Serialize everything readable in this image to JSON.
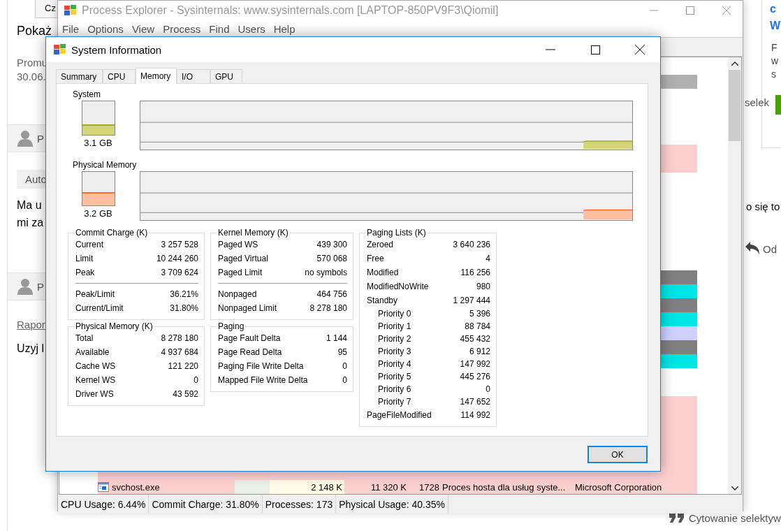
{
  "background_page": {
    "left": {
      "top_button": "Cz",
      "heading": "Pokaż",
      "meta": [
        "Promu",
        "30.06."
      ],
      "posts": [
        {
          "author": "P"
        },
        {
          "author": "P"
        }
      ],
      "label": "Auto",
      "body": [
        "Ma u",
        "mi za"
      ],
      "report_link": "Rapor",
      "body2": "Uzyj l"
    },
    "right": {
      "links": [
        "c",
        "W"
      ],
      "lines": [
        "F",
        "w",
        "s"
      ],
      "side_text": "selek",
      "body": "o się to",
      "reply": "Od",
      "quote": "Cytowanie selektyw"
    }
  },
  "process_explorer": {
    "title": "Process Explorer - Sysinternals: www.sysinternals.com [LAPTOP-850PV9F3\\Qiomil]",
    "menu": [
      "File",
      "Options",
      "View",
      "Process",
      "Find",
      "Users",
      "Help"
    ],
    "rows": [
      {
        "kind": "blank"
      },
      {
        "kind": "process",
        "color": "#b0b0b0"
      },
      {
        "kind": "blank"
      },
      {
        "kind": "blank"
      },
      {
        "kind": "blank"
      },
      {
        "kind": "blank"
      },
      {
        "kind": "process",
        "color": "#fdd0d0"
      },
      {
        "kind": "process",
        "color": "#fdd0d0"
      },
      {
        "kind": "blank"
      },
      {
        "kind": "blank"
      },
      {
        "kind": "blank"
      },
      {
        "kind": "blank"
      },
      {
        "kind": "blank"
      },
      {
        "kind": "blank"
      },
      {
        "kind": "blank"
      },
      {
        "kind": "process",
        "color": "#808080"
      },
      {
        "kind": "process",
        "color": "#00e5e5"
      },
      {
        "kind": "process",
        "color": "#808080"
      },
      {
        "kind": "process",
        "color": "#00e5e5"
      },
      {
        "kind": "process",
        "color": "#d0d0ff"
      },
      {
        "kind": "process",
        "color": "#808080"
      },
      {
        "kind": "process",
        "color": "#00e5e5"
      },
      {
        "kind": "blank"
      },
      {
        "kind": "blank"
      },
      {
        "kind": "process",
        "color": "#fdd0d0"
      },
      {
        "kind": "process",
        "color": "#fdd0d0"
      },
      {
        "kind": "process",
        "color": "#fdd0d0"
      },
      {
        "kind": "process",
        "color": "#fdd0d0"
      },
      {
        "kind": "process",
        "color": "#fdd0d0"
      },
      {
        "kind": "process",
        "color": "#fdd0d0"
      },
      {
        "kind": "process",
        "color": "#fdd0d0",
        "name": "svchost.exe",
        "private_bytes": "2 148 K",
        "working_set": "11 320 K",
        "pid": "1728",
        "description": "Proces hosta dla usług syste...",
        "company": "Microsoft Corporation"
      }
    ],
    "status_bar": [
      "CPU Usage: 6.44%",
      "Commit Charge: 31.80%",
      "Processes: 173",
      "Physical Usage: 40.35%"
    ]
  },
  "system_information": {
    "title": "System Information",
    "tabs": [
      {
        "label": "Summary",
        "selected": false
      },
      {
        "label": "CPU",
        "selected": false
      },
      {
        "label": "Memory",
        "selected": true
      },
      {
        "label": "I/O",
        "selected": false
      },
      {
        "label": "GPU",
        "selected": false
      }
    ],
    "gauges": [
      {
        "kind": "commit",
        "label": "System",
        "reading": "3.1 GB",
        "level": 0.31
      },
      {
        "kind": "physical",
        "label": "Physical Memory",
        "reading": "3.2 GB",
        "level": 0.4
      }
    ],
    "panel_columns": [
      [
        {
          "title": "Commit Charge (K)",
          "groups": [
            [
              {
                "label": "Current",
                "value": "3 257 528"
              },
              {
                "label": "Limit",
                "value": "10 244 260"
              },
              {
                "label": "Peak",
                "value": "3 709 624"
              }
            ],
            [
              {
                "label": "Peak/Limit",
                "value": "36.21%"
              },
              {
                "label": "Current/Limit",
                "value": "31.80%"
              }
            ]
          ]
        },
        {
          "title": "Physical Memory (K)",
          "groups": [
            [
              {
                "label": "Total",
                "value": "8 278 180"
              },
              {
                "label": "Available",
                "value": "4 937 684"
              },
              {
                "label": "Cache WS",
                "value": "121 220"
              },
              {
                "label": "Kernel WS",
                "value": "0"
              },
              {
                "label": "Driver WS",
                "value": "43 592"
              }
            ]
          ]
        }
      ],
      [
        {
          "title": "Kernel Memory (K)",
          "groups": [
            [
              {
                "label": "Paged WS",
                "value": "439 300"
              },
              {
                "label": "Paged Virtual",
                "value": "570 068"
              },
              {
                "label": "Paged Limit",
                "value": "no symbols"
              }
            ],
            [
              {
                "label": "Nonpaged",
                "value": "464 756"
              },
              {
                "label": "Nonpaged Limit",
                "value": "8 278 180"
              }
            ]
          ]
        },
        {
          "title": "Paging",
          "groups": [
            [
              {
                "label": "Page Fault Delta",
                "value": "1 144"
              },
              {
                "label": "Page Read Delta",
                "value": "95"
              },
              {
                "label": "Paging File Write Delta",
                "value": "0"
              },
              {
                "label": "Mapped File Write Delta",
                "value": "0"
              }
            ]
          ]
        }
      ],
      [
        {
          "title": "Paging Lists (K)",
          "groups": [
            [
              {
                "label": "Zeroed",
                "value": "3 640 236"
              },
              {
                "label": "Free",
                "value": "4"
              },
              {
                "label": "Modified",
                "value": "116 256"
              },
              {
                "label": "ModifiedNoWrite",
                "value": "980"
              },
              {
                "label": "Standby",
                "value": "1 297 444",
                "children": [
                  {
                    "label": "Priority 0",
                    "value": "5 396"
                  },
                  {
                    "label": "Priority 1",
                    "value": "88 784"
                  },
                  {
                    "label": "Priority 2",
                    "value": "455 432"
                  },
                  {
                    "label": "Priority 3",
                    "value": "6 912"
                  },
                  {
                    "label": "Priority 4",
                    "value": "147 992"
                  },
                  {
                    "label": "Priority 5",
                    "value": "445 276"
                  },
                  {
                    "label": "Priority 6",
                    "value": "0"
                  },
                  {
                    "label": "Priority 7",
                    "value": "147 652"
                  }
                ]
              },
              {
                "label": "PageFileModified",
                "value": "114 992"
              }
            ]
          ]
        }
      ]
    ],
    "ok_button": "OK"
  }
}
